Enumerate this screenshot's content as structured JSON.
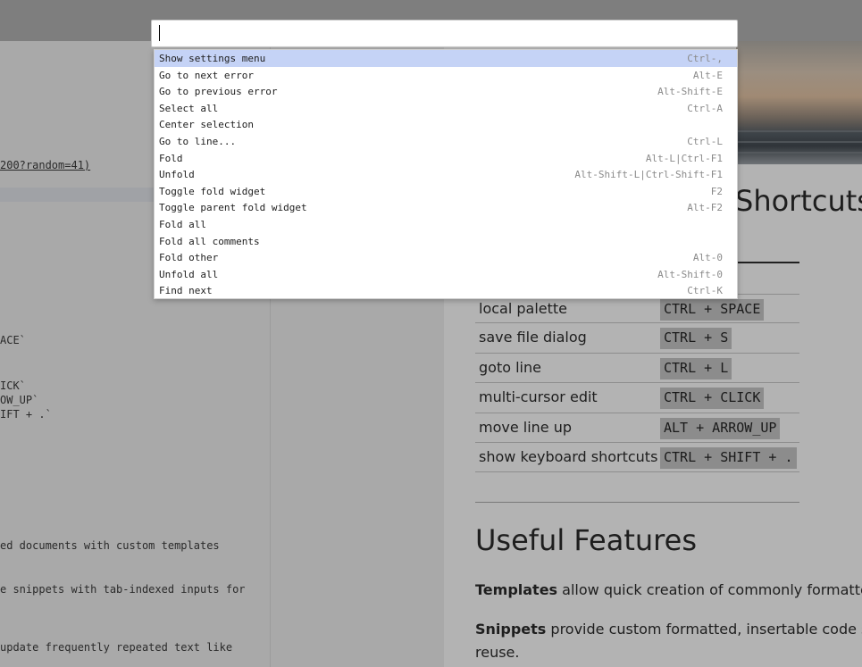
{
  "palette": {
    "input_value": "",
    "commands": [
      {
        "name": "Show settings menu",
        "key": "Ctrl-,"
      },
      {
        "name": "Go to next error",
        "key": "Alt-E"
      },
      {
        "name": "Go to previous error",
        "key": "Alt-Shift-E"
      },
      {
        "name": "Select all",
        "key": "Ctrl-A"
      },
      {
        "name": "Center selection",
        "key": ""
      },
      {
        "name": "Go to line...",
        "key": "Ctrl-L"
      },
      {
        "name": "Fold",
        "key": "Alt-L|Ctrl-F1"
      },
      {
        "name": "Unfold",
        "key": "Alt-Shift-L|Ctrl-Shift-F1"
      },
      {
        "name": "Toggle fold widget",
        "key": "F2"
      },
      {
        "name": "Toggle parent fold widget",
        "key": "Alt-F2"
      },
      {
        "name": "Fold all",
        "key": ""
      },
      {
        "name": "Fold all comments",
        "key": ""
      },
      {
        "name": "Fold other",
        "key": "Alt-0"
      },
      {
        "name": "Unfold all",
        "key": "Alt-Shift-0"
      },
      {
        "name": "Find next",
        "key": "Ctrl-K"
      }
    ]
  },
  "editor": {
    "lines": [
      "200?random=41)",
      "ACE`",
      "ICK`",
      "OW_UP`",
      "IFT + .`",
      "ed documents with custom templates",
      "e snippets with tab-indexed inputs for",
      "update frequently repeated text like"
    ]
  },
  "preview": {
    "shortcuts_heading": "Shortcuts",
    "shortcuts": [
      {
        "label": "local palette",
        "key": "CTRL + SPACE"
      },
      {
        "label": "save file dialog",
        "key": "CTRL + S"
      },
      {
        "label": "goto line",
        "key": "CTRL + L"
      },
      {
        "label": "multi-cursor edit",
        "key": "CTRL + CLICK"
      },
      {
        "label": "move line up",
        "key": "ALT + ARROW_UP"
      },
      {
        "label": "show keyboard shortcuts",
        "key": "CTRL + SHIFT + ."
      }
    ],
    "features_heading": "Useful Features",
    "templates_bold": "Templates",
    "templates_text": " allow quick creation of commonly formatted",
    "snippets_bold": "Snippets",
    "snippets_text": " provide custom formatted, insertable code sn",
    "snippets_text_2": "reuse."
  }
}
